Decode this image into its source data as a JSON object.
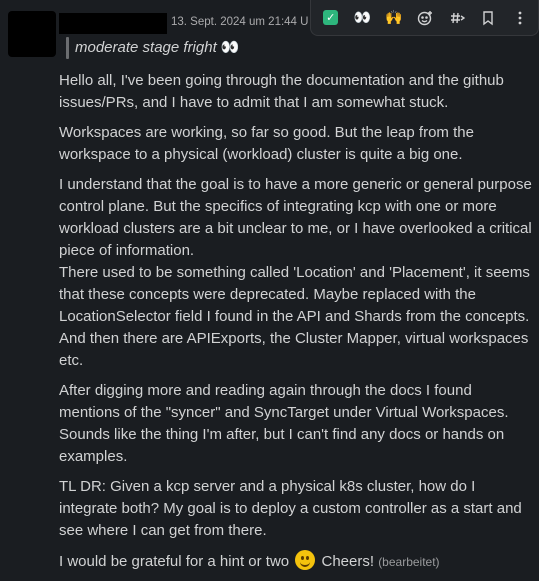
{
  "message": {
    "timestamp": "13. Sept. 2024 um 21:44 U",
    "status_text": "moderate stage fright",
    "status_emoji": "👀",
    "paragraphs": [
      "Hello all, I've been going through the documentation and the github issues/PRs, and I have to admit that I am somewhat stuck.",
      "Workspaces are working, so far so good. But the leap from the workspace to a physical (workload) cluster is quite a big one.",
      "I understand that the goal is to have a more generic or general purpose control plane. But the specifics of integrating kcp with one or more workload clusters are a bit unclear to me, or I have overlooked a critical piece of information.",
      "There used to be something called 'Location' and 'Placement', it seems that these concepts were deprecated. Maybe replaced with the LocationSelector field I found in the API and Shards from the concepts. And then there are APIExports, the Cluster Mapper, virtual workspaces etc.",
      "After digging more and reading again through the docs I found mentions of the \"syncer\" and SyncTarget under Virtual Workspaces. Sounds like the thing I'm after, but I can't find any docs or hands on examples.",
      "TL DR: Given a kcp server and a physical k8s cluster, how do I integrate both? My goal is to deploy a custom controller as a start and see where I can get from there."
    ],
    "last_line_before": "I would be grateful for a hint or two",
    "last_line_after": "Cheers!",
    "edited_label": "(bearbeitet)"
  },
  "toolbar": {
    "items": [
      {
        "name": "react-check",
        "icon": "check-mark-icon",
        "glyph": "✓"
      },
      {
        "name": "react-eyes",
        "icon": "eyes-emoji-icon",
        "glyph": "👀"
      },
      {
        "name": "react-raised-hands",
        "icon": "raised-hands-emoji-icon",
        "glyph": "🙌"
      },
      {
        "name": "add-reaction",
        "icon": "add-reaction-icon"
      },
      {
        "name": "reply-in-thread",
        "icon": "thread-icon"
      },
      {
        "name": "save",
        "icon": "bookmark-icon"
      },
      {
        "name": "more-actions",
        "icon": "more-vertical-icon"
      }
    ]
  }
}
